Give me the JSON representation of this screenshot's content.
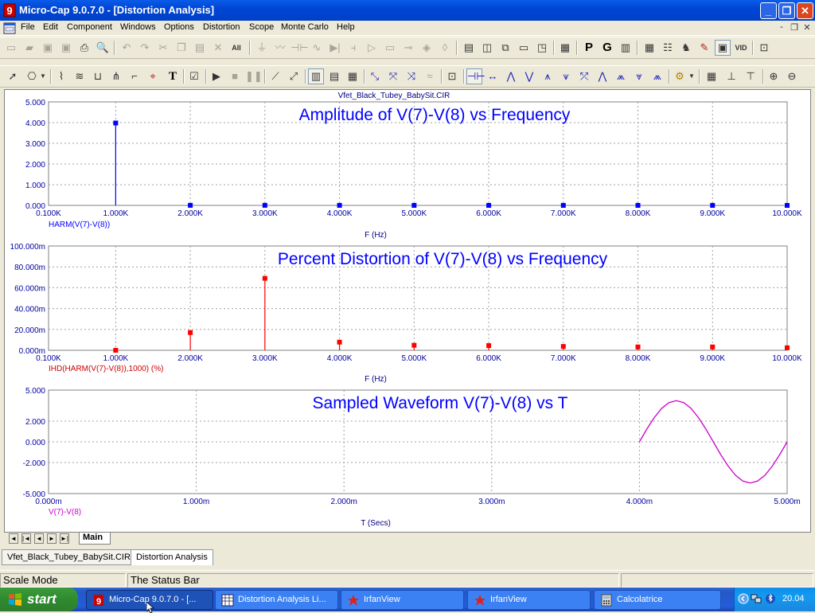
{
  "window": {
    "title": "Micro-Cap 9.0.7.0 - [Distortion Analysis]",
    "minimize_glyph": "_",
    "restore_glyph": "❐",
    "close_glyph": "✕"
  },
  "menu": {
    "items": [
      "File",
      "Edit",
      "Component",
      "Windows",
      "Options",
      "Distortion",
      "Scope",
      "Monte Carlo",
      "Help"
    ],
    "mdi_min": "-",
    "mdi_restore": "❐",
    "mdi_close": "✕"
  },
  "toolbar1_icons": [
    "new-file-icon",
    "open-folder-icon",
    "save-icon",
    "save-all-icon",
    "print-icon",
    "print-preview-icon",
    "undo-icon",
    "redo-icon",
    "cut-icon",
    "copy-icon",
    "paste-icon",
    "delete-icon",
    "select-all-icon",
    "ground-icon",
    "resistor-icon",
    "capacitor-icon",
    "inductor-icon",
    "diode-icon",
    "battery-icon",
    "opamp-icon",
    "wire-icon",
    "npn-icon",
    "junction-icon",
    "vcc-icon",
    "split-horizontal-icon",
    "split-vertical-icon",
    "cascade-icon",
    "tile-icon",
    "tile-alt-icon",
    "calculator-icon",
    "page-icon",
    "grid-icon",
    "table-icon",
    "component-editor-icon",
    "probe-icon",
    "scope-display-icon",
    "vt-display-icon",
    "zoom-window-icon"
  ],
  "toolbar1_letters": {
    "p": "P",
    "g": "G"
  },
  "toolbar2_icons": [
    "select-arrow-icon",
    "component-mode-icon",
    "text-mode-icon",
    "wire-mode-icon",
    "line-mode-icon",
    "property-icon",
    "run-icon",
    "stop-icon",
    "pause-icon",
    "scale-line-icon",
    "diagonal-line-icon",
    "grid-1-icon",
    "grid-2-icon",
    "grid-3-icon",
    "peak-icon",
    "valley-icon",
    "high-icon",
    "low-icon",
    "fft-icon",
    "left-cursor-icon",
    "right-cursor-icon",
    "slope-icon",
    "zoom-in-icon",
    "zoom-out-icon"
  ],
  "plots": {
    "filename": "Vfet_Black_Tubey_BabySit.CIR",
    "amplitude": {
      "title": "Amplitude of V(7)-V(8) vs Frequency",
      "y_ticks": [
        "5.000",
        "4.000",
        "3.000",
        "2.000",
        "1.000",
        "0.000"
      ],
      "x_ticks": [
        "0.100K",
        "1.000K",
        "2.000K",
        "3.000K",
        "4.000K",
        "5.000K",
        "6.000K",
        "7.000K",
        "8.000K",
        "9.000K",
        "10.000K"
      ],
      "trace_label": "HARM(V(7)-V(8))",
      "x_axis_label": "F (Hz)",
      "color": "#0000FF"
    },
    "distortion": {
      "title": "Percent Distortion of V(7)-V(8) vs Frequency",
      "y_ticks": [
        "100.000m",
        "80.000m",
        "60.000m",
        "40.000m",
        "20.000m",
        "0.000m"
      ],
      "x_ticks": [
        "0.100K",
        "1.000K",
        "2.000K",
        "3.000K",
        "4.000K",
        "5.000K",
        "6.000K",
        "7.000K",
        "8.000K",
        "9.000K",
        "10.000K"
      ],
      "trace_label": "IHD(HARM(V(7)-V(8)),1000) (%)",
      "x_axis_label": "F (Hz)",
      "color": "#FF0000"
    },
    "waveform": {
      "title": "Sampled Waveform  V(7)-V(8) vs T",
      "y_ticks": [
        "5.000",
        "2.000",
        "0.000",
        "-2.000",
        "-5.000"
      ],
      "x_ticks": [
        "0.000m",
        "1.000m",
        "2.000m",
        "3.000m",
        "4.000m",
        "5.000m"
      ],
      "trace_label": "V(7)-V(8)",
      "x_axis_label": "T (Secs)",
      "color": "#CC00CC"
    }
  },
  "chart_data": [
    {
      "type": "bar",
      "title": "Amplitude of V(7)-V(8) vs Frequency",
      "xlabel": "F (Hz)",
      "ylabel": "HARM(V(7)-V(8))",
      "x": [
        1000,
        2000,
        3000,
        4000,
        5000,
        6000,
        7000,
        8000,
        9000,
        10000
      ],
      "values": [
        3.98,
        0.003,
        0.004,
        0.002,
        0.001,
        0.001,
        0.001,
        0.001,
        0.001,
        0.0
      ],
      "xlim": [
        100,
        10000
      ],
      "ylim": [
        0,
        5
      ],
      "grid": true
    },
    {
      "type": "bar",
      "title": "Percent Distortion of V(7)-V(8) vs Frequency",
      "xlabel": "F (Hz)",
      "ylabel": "IHD(HARM(V(7)-V(8)),1000) (%)",
      "x": [
        1000,
        2000,
        3000,
        4000,
        5000,
        6000,
        7000,
        8000,
        9000,
        10000
      ],
      "values": [
        0.0,
        17.0,
        69.0,
        7.8,
        4.8,
        4.5,
        3.7,
        3.2,
        3.2,
        2.4
      ],
      "unit": "m",
      "xlim": [
        100,
        10000
      ],
      "ylim": [
        0,
        100
      ],
      "grid": true
    },
    {
      "type": "line",
      "title": "Sampled Waveform  V(7)-V(8) vs T",
      "xlabel": "T (Secs)",
      "ylabel": "V(7)-V(8)",
      "x_unit": "ms",
      "x": [
        4.0,
        4.05,
        4.1,
        4.15,
        4.2,
        4.25,
        4.3,
        4.35,
        4.4,
        4.45,
        4.5,
        4.55,
        4.6,
        4.65,
        4.7,
        4.75,
        4.8,
        4.85,
        4.9,
        4.95,
        5.0
      ],
      "values": [
        0.0,
        1.23,
        2.34,
        3.22,
        3.79,
        3.98,
        3.79,
        3.22,
        2.34,
        1.23,
        0.0,
        -1.23,
        -2.34,
        -3.22,
        -3.79,
        -3.98,
        -3.79,
        -3.22,
        -2.34,
        -1.23,
        0.0
      ],
      "xlim": [
        0,
        5
      ],
      "ylim": [
        -5,
        5
      ],
      "grid": true
    }
  ],
  "sheet": {
    "tab_label": "Main",
    "nav": [
      "◄",
      "|◄",
      "◄",
      "►",
      "►|"
    ]
  },
  "doc_tabs": [
    "Vfet_Black_Tubey_BabySit.CIR",
    "Distortion Analysis"
  ],
  "status": {
    "mode": "Scale Mode",
    "message": "The Status Bar"
  },
  "taskbar": {
    "start_label": "start",
    "tasks": [
      "Micro-Cap 9.0.7.0 - [...",
      "Distortion Analysis Li...",
      "IrfanView",
      "IrfanView",
      "Calcolatrice"
    ],
    "clock": "20.04"
  }
}
